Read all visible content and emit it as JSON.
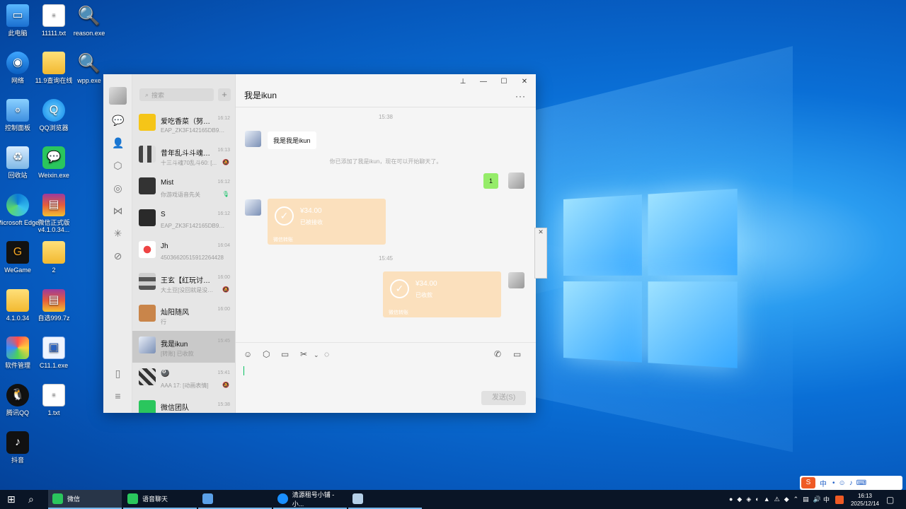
{
  "desktop": {
    "icons": [
      {
        "label": "此电脑",
        "icon": "computer-icon"
      },
      {
        "label": "11111.txt",
        "icon": "text-file-icon"
      },
      {
        "label": "reason.exe",
        "icon": "magnifier-icon"
      },
      {
        "label": "网络",
        "icon": "network-icon"
      },
      {
        "label": "11.9查询在线",
        "icon": "folder-icon"
      },
      {
        "label": "wpp.exe",
        "icon": "magnifier-icon"
      },
      {
        "label": "控制面板",
        "icon": "control-panel-icon"
      },
      {
        "label": "QQ浏览器",
        "icon": "qq-browser-icon"
      },
      {
        "label": "回收站",
        "icon": "recycle-bin-icon"
      },
      {
        "label": "Weixin.exe",
        "icon": "wechat-icon"
      },
      {
        "label": "Microsoft Edge",
        "icon": "edge-icon"
      },
      {
        "label": "微信正式版 v4.1.0.34...",
        "icon": "winrar-icon"
      },
      {
        "label": "WeGame",
        "icon": "wegame-icon"
      },
      {
        "label": "2",
        "icon": "folder-icon"
      },
      {
        "label": "4.1.0.34",
        "icon": "folder-icon"
      },
      {
        "label": "自选999.7z",
        "icon": "winrar-icon"
      },
      {
        "label": "软件管理",
        "icon": "software-manager-icon"
      },
      {
        "label": "C11.1.exe",
        "icon": "exe-icon"
      },
      {
        "label": "腾讯QQ",
        "icon": "qq-icon"
      },
      {
        "label": "1.txt",
        "icon": "text-file-icon"
      },
      {
        "label": "抖音",
        "icon": "douyin-icon"
      }
    ]
  },
  "wechat": {
    "search_placeholder": "搜索",
    "plus": "+",
    "conversations": [
      {
        "name": "爱吃香菜（努力...",
        "preview": "EAP_ZK3F142165DB974...",
        "time": "16:12",
        "flag": ""
      },
      {
        "name": "昔年乱斗斗魂技...",
        "preview": "十三斗魂70乱斗60: [...",
        "time": "16:13",
        "flag": "🔕"
      },
      {
        "name": "Mist",
        "preview": "你游戏语音先关",
        "time": "16:12",
        "flag": "🎙"
      },
      {
        "name": "S",
        "preview": "EAP_ZK3F142165DB974...",
        "time": "16:12",
        "flag": ""
      },
      {
        "name": "Jh",
        "preview": "4503662051591226442​8",
        "time": "16:04",
        "flag": ""
      },
      {
        "name": "王玄【红玩讨论...",
        "preview": "大土豆[没回就是没看...",
        "time": "16:00",
        "flag": "🔕"
      },
      {
        "name": "灿阳随风",
        "preview": "行",
        "time": "16:00",
        "flag": ""
      },
      {
        "name": "我是ikun",
        "preview": "[转账] 已收款",
        "time": "15:45",
        "flag": ""
      },
      {
        "name": "🎱",
        "preview": "AAA 17: [动画表情]",
        "time": "15:41",
        "flag": "🔕"
      },
      {
        "name": "微信团队",
        "preview": "",
        "time": "15:38",
        "flag": ""
      }
    ],
    "chat": {
      "title": "我是ikun",
      "more": "···",
      "ts1": "15:38",
      "msg1": "我是我是ikun",
      "system": "你已添加了我是ikun，现在可以开始聊天了。",
      "msg2": "1",
      "transfer1": {
        "amount": "¥34.00",
        "status": "已被接收",
        "footer": "微信转账"
      },
      "ts2": "15:45",
      "transfer2": {
        "amount": "¥34.00",
        "status": "已收款",
        "footer": "微信转账"
      },
      "send": "发送(S)"
    }
  },
  "taskbar": {
    "apps": [
      {
        "label": "微信"
      },
      {
        "label": "语音聊天"
      },
      {
        "label": ""
      },
      {
        "label": "清源租号小铺 - 小..."
      },
      {
        "label": ""
      }
    ],
    "ime": "中",
    "clock_time": "16:13",
    "clock_date": "2025/12/14"
  }
}
